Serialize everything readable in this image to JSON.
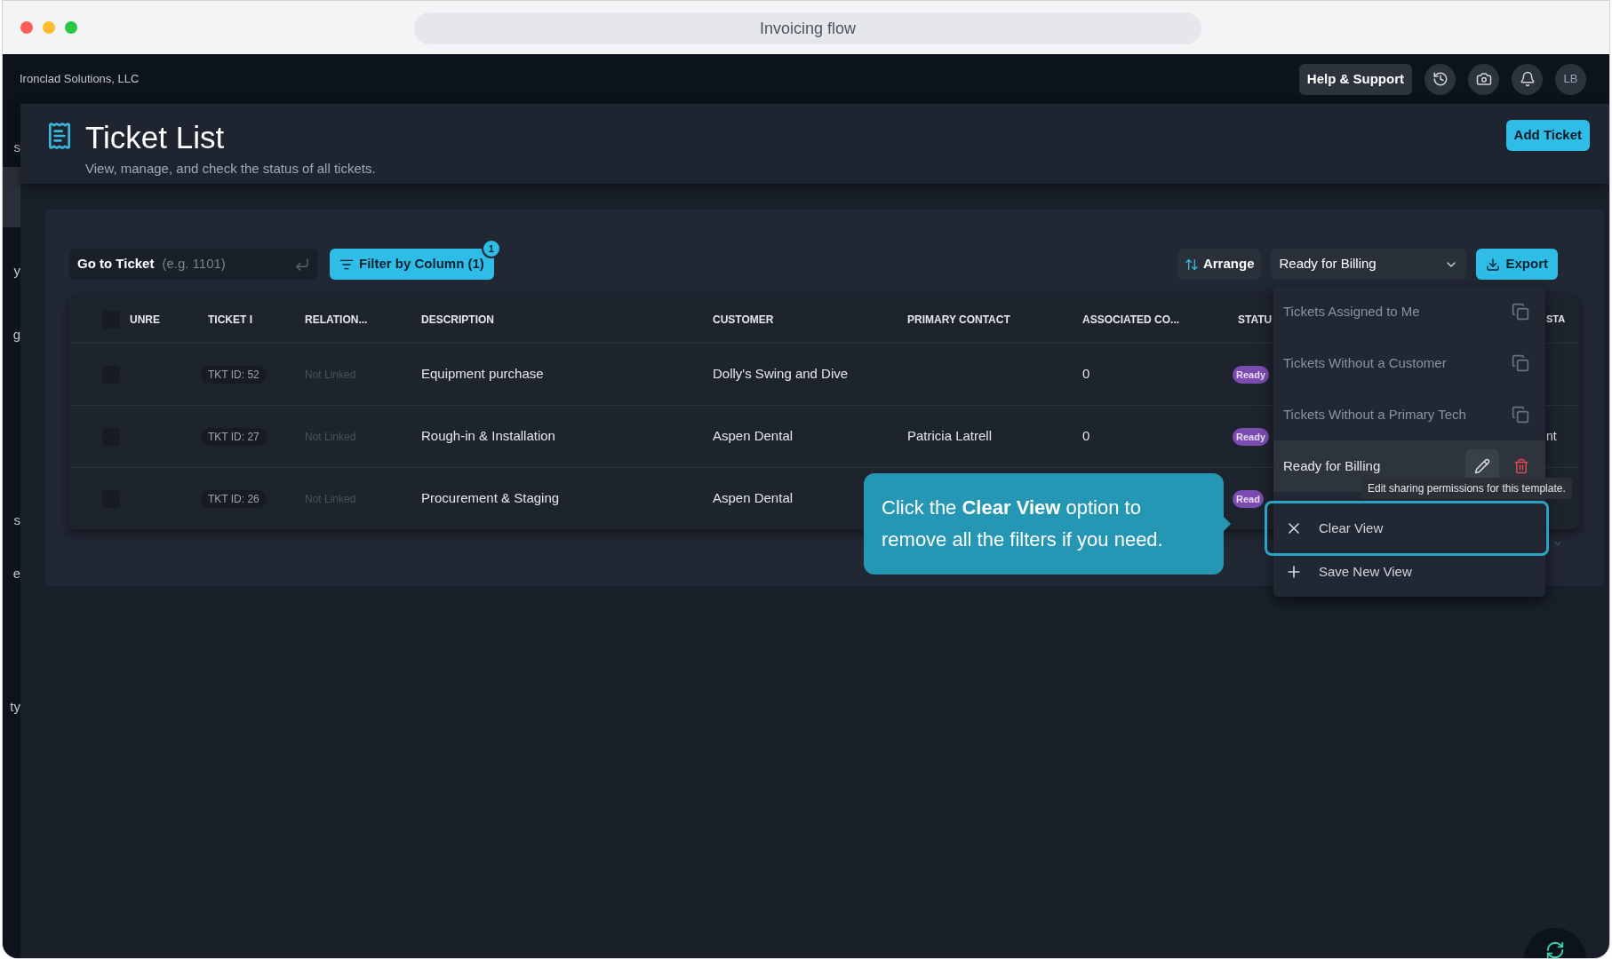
{
  "window": {
    "title": "Invoicing flow"
  },
  "header": {
    "company": "Ironclad Solutions, LLC",
    "help_button": "Help & Support",
    "avatar": "LB"
  },
  "sidebar": {
    "items": [
      {
        "label": "s",
        "selected": false
      },
      {
        "selected": true
      },
      {
        "label": "y",
        "selected": false
      },
      {
        "label": "g",
        "selected": false
      },
      {
        "label": "s",
        "selected": false
      },
      {
        "label": "e",
        "selected": false
      },
      {
        "label": "ty",
        "selected": false
      }
    ]
  },
  "page": {
    "title": "Ticket List",
    "subtitle": "View, manage, and check the status of all tickets.",
    "add_button": "Add Ticket"
  },
  "toolbar": {
    "goto_label": "Go to Ticket",
    "goto_placeholder": "(e.g. 1101)",
    "filter_button": "Filter by Column (1)",
    "filter_badge": "1",
    "arrange_button": "Arrange",
    "view_select": "Ready for Billing",
    "export_button": "Export"
  },
  "table": {
    "all_checked": false,
    "columns": [
      "UNRE",
      "TICKET I",
      "RELATION...",
      "DESCRIPTION",
      "CUSTOMER",
      "PRIMARY CONTACT",
      "ASSOCIATED CO...",
      "STATU",
      "STA"
    ],
    "rows": [
      {
        "checked": false,
        "ticket_id": "TKT ID: 52",
        "relation": "Not Linked",
        "description": "Equipment purchase",
        "customer": "Dolly's Swing and Dive",
        "associated_count": "0",
        "status": "Ready"
      },
      {
        "checked": false,
        "ticket_id": "TKT ID: 27",
        "relation": "Not Linked",
        "description": "Rough-in & Installation",
        "customer": "Aspen Dental",
        "primary_contact": "Patricia Latrell",
        "associated_count": "0",
        "status": "Ready",
        "column_10": "nt"
      },
      {
        "checked": false,
        "ticket_id": "TKT ID: 26",
        "relation": "Not Linked",
        "description": "Procurement & Staging",
        "customer": "Aspen Dental",
        "status": "Read"
      }
    ]
  },
  "menu": {
    "items": [
      {
        "kind": "template",
        "label": "Tickets Assigned to Me",
        "selected": false
      },
      {
        "kind": "template",
        "label": "Tickets Without a Customer",
        "selected": false
      },
      {
        "kind": "template",
        "label": "Tickets Without a Primary Tech",
        "selected": false
      },
      {
        "kind": "template",
        "label": "Ready for Billing",
        "selected": true
      },
      {
        "kind": "clear",
        "label": "Clear View"
      },
      {
        "kind": "save",
        "label": "Save New View"
      }
    ]
  },
  "tooltip": "Edit sharing permissions for this template.",
  "callout": {
    "text": "Click the **Clear View** option to remove all the filters if you need."
  }
}
